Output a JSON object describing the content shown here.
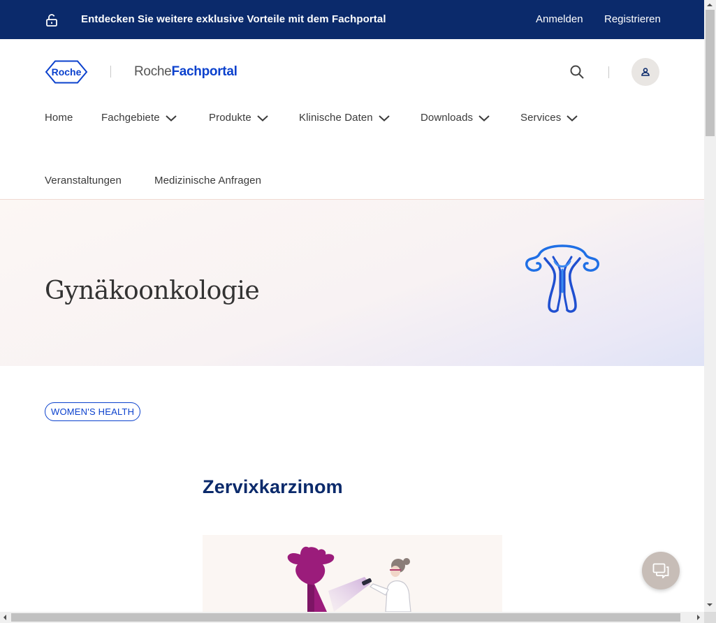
{
  "topbar": {
    "promo": "Entdecken Sie weitere exklusive Vorteile mit dem Fachportal",
    "login": "Anmelden",
    "register": "Registrieren",
    "lock_icon": "unlocked-padlock-icon"
  },
  "header": {
    "logo_text": "Roche",
    "portal_prefix": "Roche",
    "portal_suffix": "Fachportal",
    "search_icon": "search-icon",
    "user_icon": "user-icon"
  },
  "nav": {
    "items": [
      {
        "label": "Home",
        "dropdown": false
      },
      {
        "label": "Fachgebiete",
        "dropdown": true
      },
      {
        "label": "Produkte",
        "dropdown": true
      },
      {
        "label": "Klinische Daten",
        "dropdown": true
      },
      {
        "label": "Downloads",
        "dropdown": true
      },
      {
        "label": "Services",
        "dropdown": true
      },
      {
        "label": "Veranstaltungen",
        "dropdown": false
      },
      {
        "label": "Medizinische Anfragen",
        "dropdown": false
      }
    ]
  },
  "hero": {
    "title": "Gynäkoonkologie",
    "icon": "uterus-icon"
  },
  "tag": {
    "label": "WOMEN'S HEALTH"
  },
  "section": {
    "title": "Zervixkarzinom"
  },
  "chat": {
    "icon": "chat-icon"
  },
  "colors": {
    "topbar_bg": "#0b2a6b",
    "brand_blue": "#0b41cd",
    "hero_gradient_end": "#dfe3f6",
    "chat_bg": "#c7bdb7"
  }
}
